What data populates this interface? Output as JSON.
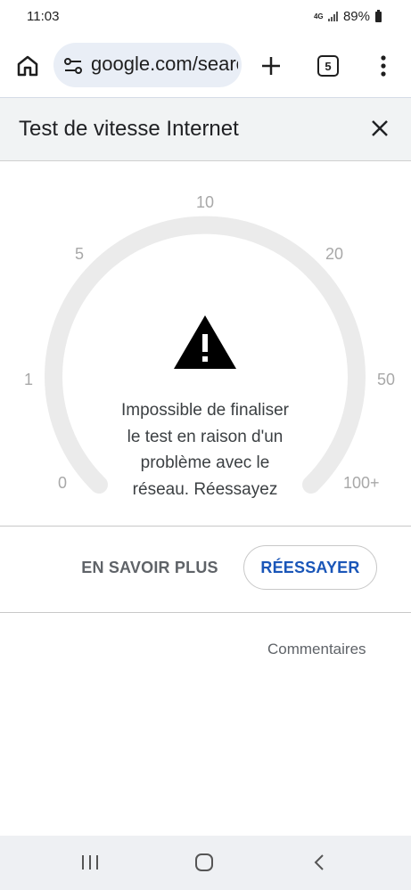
{
  "status_bar": {
    "time": "11:03",
    "network": "4G",
    "battery": "89%"
  },
  "toolbar": {
    "url": "google.com/search",
    "tab_count": "5"
  },
  "sheet": {
    "title": "Test de vitesse Internet"
  },
  "gauge": {
    "tick_labels": [
      "0",
      "1",
      "5",
      "10",
      "20",
      "50",
      "100+"
    ],
    "error_message": "Impossible de finaliser le test en raison d'un problème avec le réseau. Réessayez"
  },
  "actions": {
    "learn_more": "EN SAVOIR PLUS",
    "retry": "RÉESSAYER"
  },
  "feedback": {
    "label": "Commentaires"
  },
  "colors": {
    "accent": "#1a56b8",
    "gauge_track": "#ebebeb",
    "omnibox_bg": "#e9eef6",
    "header_bg": "#f1f3f4",
    "nav_bg": "#eef0f3"
  }
}
